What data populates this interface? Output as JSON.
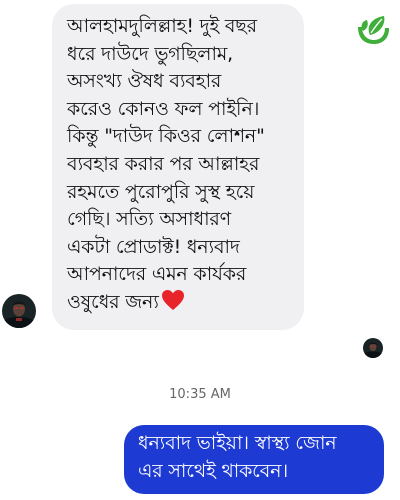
{
  "incoming_message": {
    "lines": [
      "আলহামদুলিল্লাহ! দুই বছর",
      "ধরে দাউদে ভুগছিলাম,",
      "অসংখ্য ঔষধ ব্যবহার",
      "করেও কোনও ফল পাইনি।",
      "কিন্তু \"দাউদ কিওর লোশন\"",
      "ব্যবহার করার পর আল্লাহর",
      "রহমতে পুরোপুরি সুস্থ হয়ে",
      "গেছি। সত্যি অসাধারণ",
      "একটা প্রোডাক্ট! ধন্যবাদ",
      "আপনাদের এমন কার্যকর",
      "ওষুধের জন্য"
    ],
    "emoji": "heart-icon"
  },
  "timestamp": "10:35 AM",
  "outgoing_message": {
    "lines": [
      "ধন্যবাদ ভাইয়া। স্বাস্থ্য জোন",
      "এর সাথেই থাকবেন।"
    ]
  },
  "logo": "leaf-logo-icon",
  "colors": {
    "incoming_bubble": "#f0f0f3",
    "outgoing_bubble": "#1d3bd3",
    "logo_green": "#3fae3a",
    "heart": "#e8242b"
  }
}
